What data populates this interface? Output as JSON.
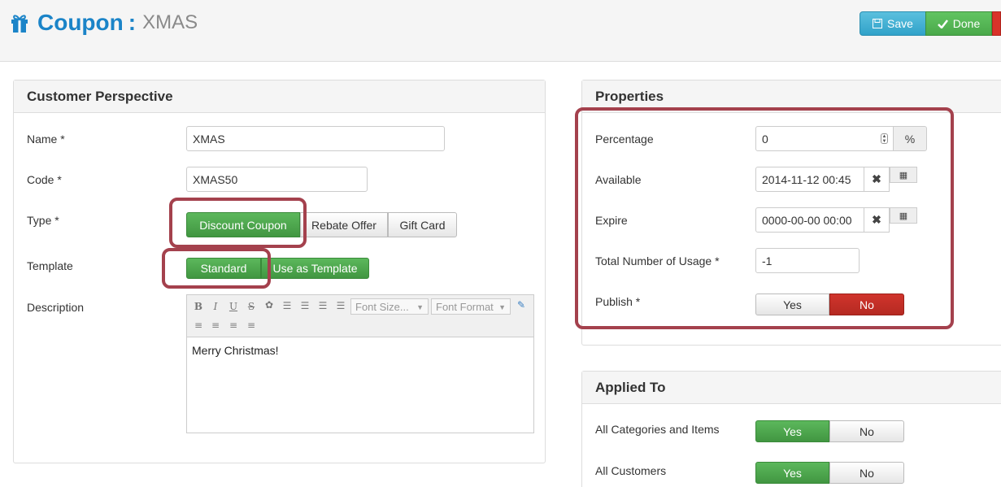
{
  "header": {
    "title_prefix": "Coupon",
    "title_sep": ":",
    "title_name": "XMAS",
    "save_label": "Save",
    "done_label": "Done"
  },
  "customer": {
    "panel_title": "Customer Perspective",
    "name_label": "Name *",
    "name_value": "XMAS",
    "code_label": "Code *",
    "code_value": "XMAS50",
    "type_label": "Type *",
    "type_options": [
      "Discount Coupon",
      "Rebate Offer",
      "Gift Card"
    ],
    "type_selected": "Discount Coupon",
    "template_label": "Template",
    "template_options": [
      "Standard",
      "Use as Template"
    ],
    "template_selected": "Standard",
    "description_label": "Description",
    "editor": {
      "font_size": "Font Size...",
      "font_format": "Font Format",
      "content": "Merry Christmas!"
    }
  },
  "properties": {
    "panel_title": "Properties",
    "percentage_label": "Percentage",
    "percentage_value": "0",
    "percentage_unit": "%",
    "available_label": "Available",
    "available_value": "2014-11-12 00:45",
    "expire_label": "Expire",
    "expire_value": "0000-00-00 00:00",
    "usage_label": "Total Number of Usage *",
    "usage_value": "-1",
    "publish_label": "Publish *",
    "publish_yes": "Yes",
    "publish_no": "No",
    "publish_selected": "No"
  },
  "applied": {
    "panel_title": "Applied To",
    "categories_label": "All Categories and Items",
    "categories_yes": "Yes",
    "categories_no": "No",
    "categories_selected": "Yes",
    "customers_label": "All Customers",
    "customers_yes": "Yes",
    "customers_no": "No",
    "customers_selected": "Yes"
  },
  "colors": {
    "brand_blue": "#1b84c8",
    "save_blue": "#31a2c9",
    "done_green": "#4aa94a",
    "no_red": "#b52a22",
    "highlight": "#a4414d"
  },
  "icons": [
    "gift-icon",
    "floppy-disk-icon",
    "check-icon",
    "close-icon",
    "calendar-icon",
    "spinner-icon"
  ]
}
